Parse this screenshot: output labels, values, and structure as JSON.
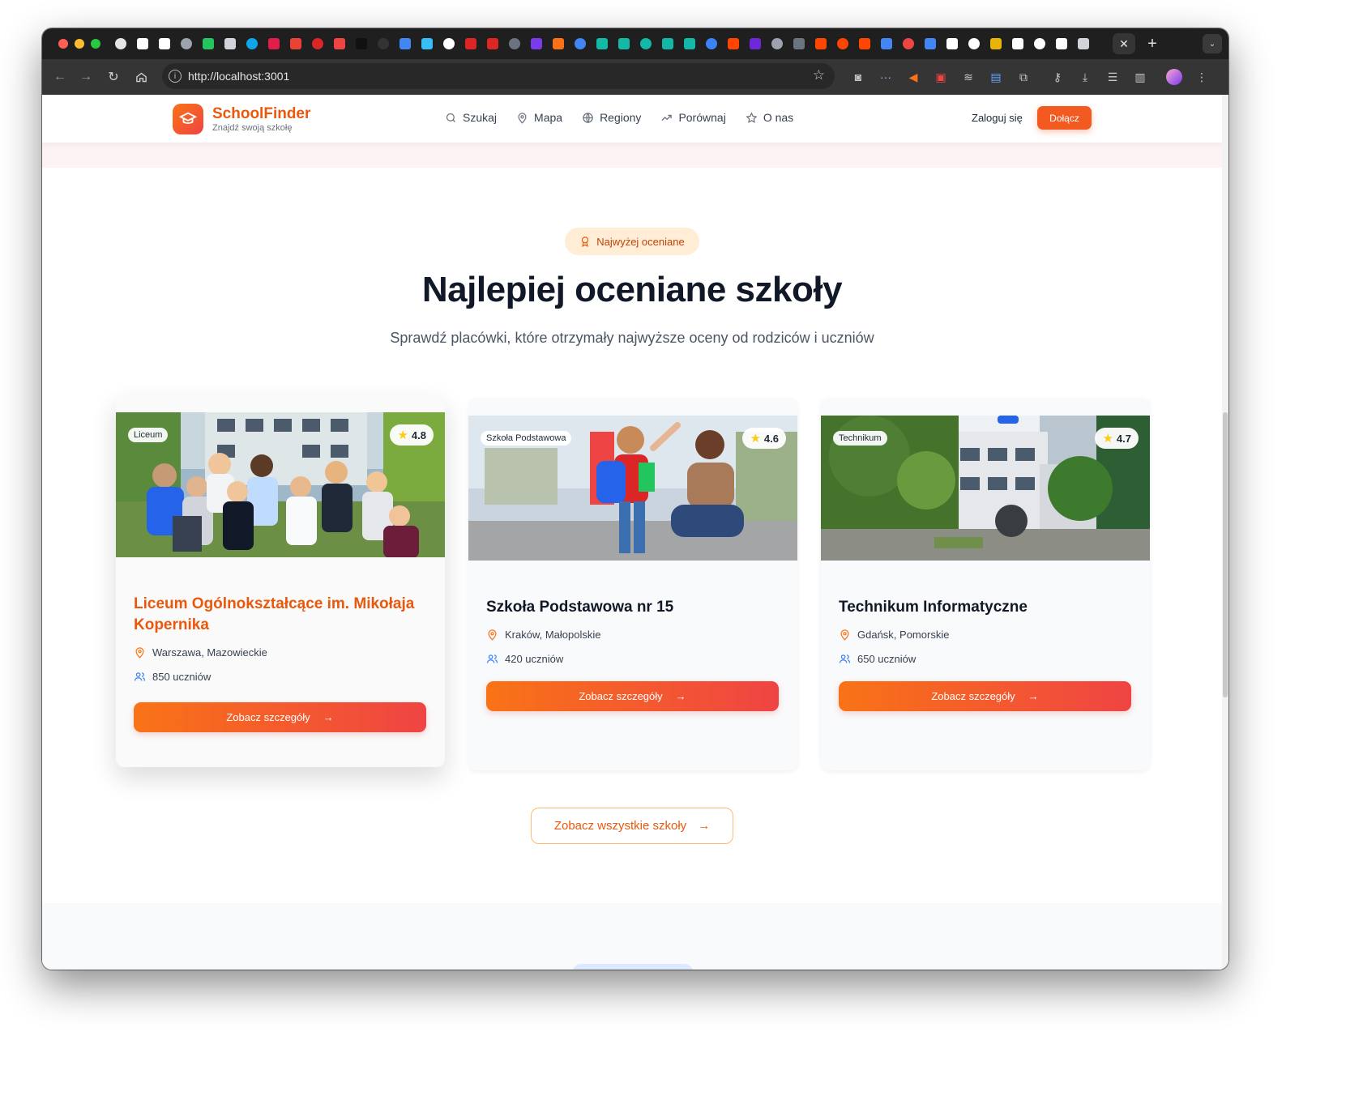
{
  "browser": {
    "url": "http://localhost:3001",
    "tab_colors": [
      "#e5e5e5",
      "#ffffff",
      "#ffffff",
      "#9ca3af",
      "#22c55e",
      "#d1d5db",
      "#0ea5e9",
      "#e11d48",
      "#ea4335",
      "#dc2626",
      "#ef4444",
      "#111111",
      "#333333",
      "#4285f4",
      "#38bdf8",
      "#ffffff",
      "#dc2626",
      "#dc2626",
      "#6b7280",
      "#7c3aed",
      "#f97316",
      "#4285f4",
      "#14b8a6",
      "#14b8a6",
      "#14b8a6",
      "#14b8a6",
      "#14b8a6",
      "#3b82f6",
      "#ff4500",
      "#6d28d9",
      "#9ca3af",
      "#6b7280",
      "#ff4500",
      "#ff4500",
      "#ff4500",
      "#4285f4",
      "#ef4444",
      "#4285f4",
      "#ffffff",
      "#ffffff",
      "#eab308",
      "#ffffff",
      "#ffffff",
      "#ffffff",
      "#d1d5db"
    ],
    "close_tab_icon": "close-icon",
    "new_tab_icon": "plus-icon"
  },
  "header": {
    "brand": "SchoolFinder",
    "brand_sub": "Znajdź swoją szkołę",
    "nav": [
      {
        "label": "Szukaj",
        "icon": "search-icon"
      },
      {
        "label": "Mapa",
        "icon": "map-pin-icon"
      },
      {
        "label": "Regiony",
        "icon": "globe-icon"
      },
      {
        "label": "Porównaj",
        "icon": "trending-icon"
      },
      {
        "label": "O nas",
        "icon": "star-icon"
      }
    ],
    "login": "Zaloguj się",
    "join": "Dołącz"
  },
  "section": {
    "pill": "Najwyżej oceniane",
    "title": "Najlepiej oceniane szkoły",
    "subtitle": "Sprawdź placówki, które otrzymały najwyższe oceny od rodziców i uczniów"
  },
  "schools": [
    {
      "type": "Liceum",
      "rating": "4.8",
      "name": "Liceum Ogólnokształcące im. Mikołaja Kopernika",
      "location": "Warszawa, Mazowieckie",
      "students": "850 uczniów",
      "cta": "Zobacz szczegóły"
    },
    {
      "type": "Szkoła Podstawowa",
      "rating": "4.6",
      "name": "Szkoła Podstawowa nr 15",
      "location": "Kraków, Małopolskie",
      "students": "420 uczniów",
      "cta": "Zobacz szczegóły"
    },
    {
      "type": "Technikum",
      "rating": "4.7",
      "name": "Technikum Informatyczne",
      "location": "Gdańsk, Pomorskie",
      "students": "650 uczniów",
      "cta": "Zobacz szczegóły"
    }
  ],
  "see_all": "Zobacz wszystkie szkoły",
  "colors": {
    "accent": "#f97316",
    "accent2": "#ef4444",
    "title": "#111827"
  }
}
